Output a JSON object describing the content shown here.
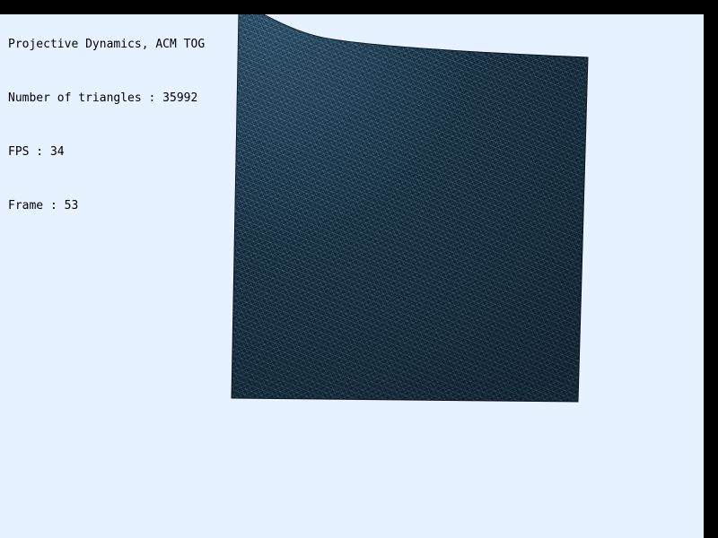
{
  "hud": {
    "title": "Projective Dynamics, ACM TOG",
    "triangles": "Number of triangles : 35992",
    "fps": "FPS : 34",
    "frame": "Frame : 53"
  },
  "colors": {
    "background": "#e6f2ff",
    "border": "#000000",
    "cloth_base": "#1c3347",
    "cloth_wire": "#5aa7cf",
    "cloth_dark": "#0b1620"
  },
  "scene": {
    "object": "cloth-mesh"
  }
}
